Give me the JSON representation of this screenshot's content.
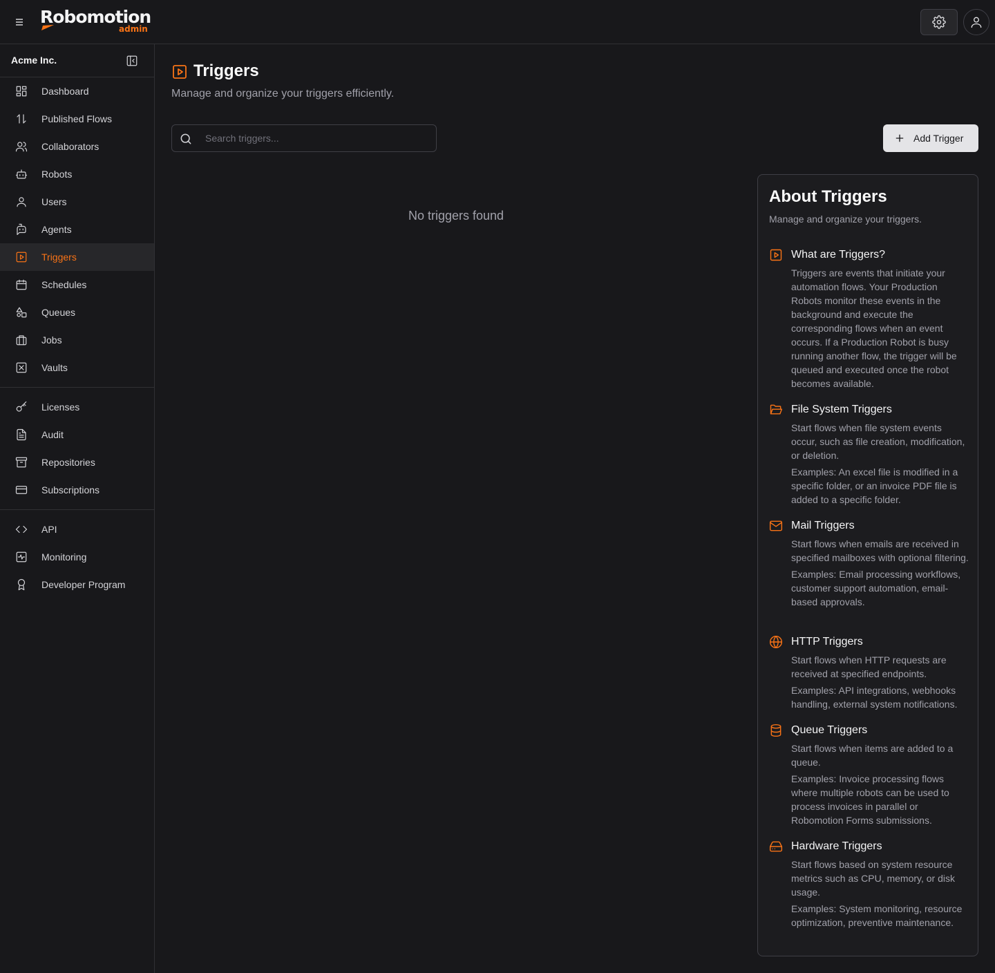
{
  "app": {
    "logo_text": "Robomotion",
    "logo_sub": "admin"
  },
  "org": {
    "name": "Acme Inc."
  },
  "sidebar": {
    "groups": [
      [
        {
          "label": "Dashboard",
          "icon": "dashboard-icon"
        },
        {
          "label": "Published Flows",
          "icon": "arrows-updown-icon"
        },
        {
          "label": "Collaborators",
          "icon": "users-icon"
        },
        {
          "label": "Robots",
          "icon": "robot-icon"
        },
        {
          "label": "Users",
          "icon": "user-icon"
        },
        {
          "label": "Agents",
          "icon": "agent-icon"
        },
        {
          "label": "Triggers",
          "icon": "play-square-icon",
          "active": true
        },
        {
          "label": "Schedules",
          "icon": "calendar-icon"
        },
        {
          "label": "Queues",
          "icon": "shapes-icon"
        },
        {
          "label": "Jobs",
          "icon": "briefcase-icon"
        },
        {
          "label": "Vaults",
          "icon": "vault-icon"
        }
      ],
      [
        {
          "label": "Licenses",
          "icon": "key-icon"
        },
        {
          "label": "Audit",
          "icon": "document-icon"
        },
        {
          "label": "Repositories",
          "icon": "archive-icon"
        },
        {
          "label": "Subscriptions",
          "icon": "credit-card-icon"
        }
      ],
      [
        {
          "label": "API",
          "icon": "code-icon"
        },
        {
          "label": "Monitoring",
          "icon": "activity-icon"
        },
        {
          "label": "Developer Program",
          "icon": "award-icon"
        }
      ]
    ]
  },
  "page": {
    "title": "Triggers",
    "subtitle": "Manage and organize your triggers efficiently.",
    "search_placeholder": "Search triggers...",
    "search_value": "",
    "add_button": "Add Trigger",
    "empty_message": "No triggers found"
  },
  "about": {
    "title": "About Triggers",
    "subtitle": "Manage and organize your triggers.",
    "topics": [
      {
        "icon": "play-square-icon",
        "title": "What are Triggers?",
        "paragraphs": [
          "Triggers are events that initiate your automation flows. Your Production Robots monitor these events in the background and execute the corresponding flows when an event occurs. If a Production Robot is busy running another flow, the trigger will be queued and executed once the robot becomes available."
        ]
      },
      {
        "icon": "folder-open-icon",
        "title": "File System Triggers",
        "paragraphs": [
          "Start flows when file system events occur, such as file creation, modification, or deletion.",
          "Examples: An excel file is modified in a specific folder, or an invoice PDF file is added to a specific folder."
        ]
      },
      {
        "icon": "mail-icon",
        "title": "Mail Triggers",
        "paragraphs": [
          "Start flows when emails are received in specified mailboxes with optional filtering.",
          "Examples: Email processing workflows, customer support automation, email-based approvals."
        ]
      },
      {
        "icon": "globe-icon",
        "title": "HTTP Triggers",
        "paragraphs": [
          "Start flows when HTTP requests are received at specified endpoints.",
          "Examples: API integrations, webhooks handling, external system notifications."
        ]
      },
      {
        "icon": "database-icon",
        "title": "Queue Triggers",
        "paragraphs": [
          "Start flows when items are added to a queue.",
          "Examples: Invoice processing flows where multiple robots can be used to process invoices in parallel or Robomotion Forms submissions."
        ]
      },
      {
        "icon": "hard-drive-icon",
        "title": "Hardware Triggers",
        "paragraphs": [
          "Start flows based on system resource metrics such as CPU, memory, or disk usage.",
          "Examples: System monitoring, resource optimization, preventive maintenance."
        ]
      }
    ]
  },
  "colors": {
    "accent": "#f97316",
    "background": "#18181b",
    "panel": "#1c1c1f",
    "border": "#303034"
  }
}
